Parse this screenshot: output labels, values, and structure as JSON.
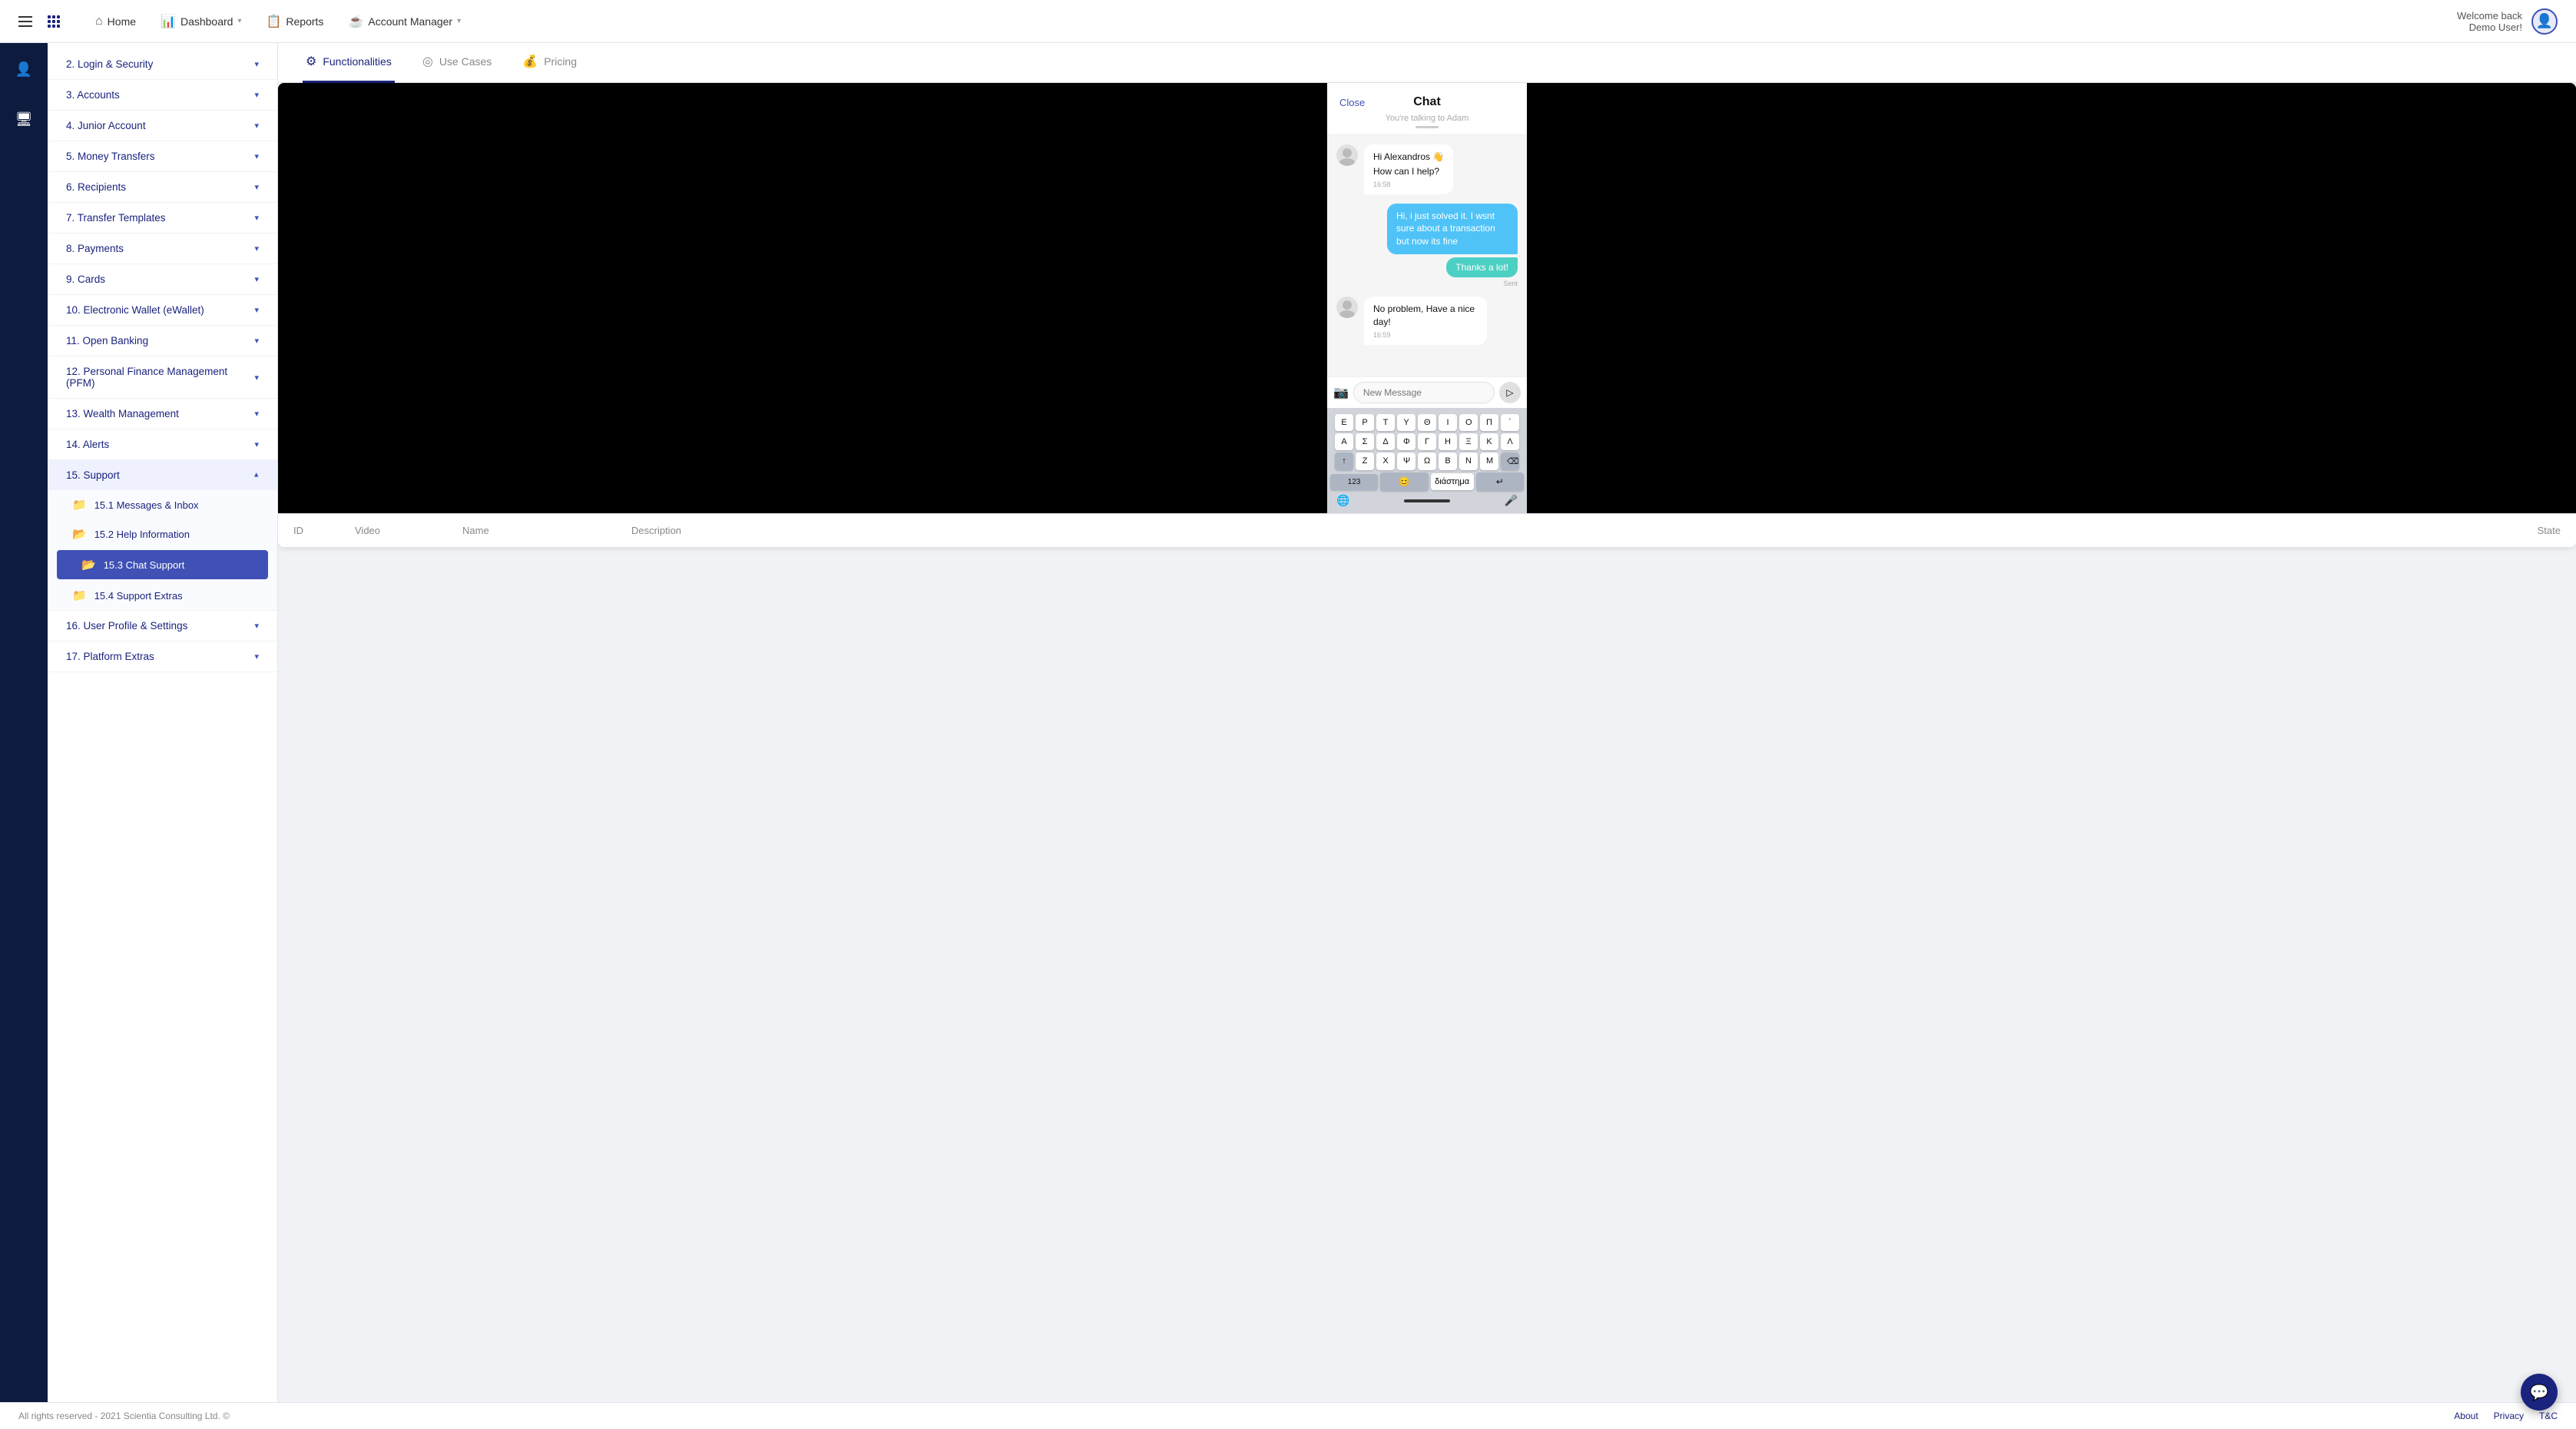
{
  "topnav": {
    "home_label": "Home",
    "dashboard_label": "Dashboard",
    "reports_label": "Reports",
    "account_manager_label": "Account Manager",
    "welcome_text": "Welcome back",
    "user_text": "Demo User!"
  },
  "tabs": {
    "functionalities_label": "Functionalities",
    "use_cases_label": "Use Cases",
    "pricing_label": "Pricing"
  },
  "sidebar": {
    "sections": [
      {
        "id": "login-security",
        "label": "2. Login & Security",
        "expanded": false
      },
      {
        "id": "accounts",
        "label": "3. Accounts",
        "expanded": false
      },
      {
        "id": "junior-account",
        "label": "4. Junior Account",
        "expanded": false
      },
      {
        "id": "money-transfers",
        "label": "5. Money Transfers",
        "expanded": false
      },
      {
        "id": "recipients",
        "label": "6. Recipients",
        "expanded": false
      },
      {
        "id": "transfer-templates",
        "label": "7. Transfer Templates",
        "expanded": false
      },
      {
        "id": "payments",
        "label": "8. Payments",
        "expanded": false
      },
      {
        "id": "cards",
        "label": "9. Cards",
        "expanded": false
      },
      {
        "id": "ewallet",
        "label": "10. Electronic Wallet (eWallet)",
        "expanded": false
      },
      {
        "id": "open-banking",
        "label": "11. Open Banking",
        "expanded": false
      },
      {
        "id": "pfm",
        "label": "12. Personal Finance Management (PFM)",
        "expanded": false
      },
      {
        "id": "wealth-management",
        "label": "13. Wealth Management",
        "expanded": false
      },
      {
        "id": "alerts",
        "label": "14. Alerts",
        "expanded": false
      },
      {
        "id": "support",
        "label": "15. Support",
        "expanded": true
      }
    ],
    "support_sub_items": [
      {
        "id": "messages-inbox",
        "label": "15.1 Messages & Inbox",
        "active": false
      },
      {
        "id": "help-information",
        "label": "15.2 Help Information",
        "active": false
      },
      {
        "id": "chat-support",
        "label": "15.3 Chat Support",
        "active": true
      },
      {
        "id": "support-extras",
        "label": "15.4 Support Extras",
        "active": false
      }
    ],
    "more_sections": [
      {
        "id": "user-profile",
        "label": "16. User Profile & Settings",
        "expanded": false
      },
      {
        "id": "platform-extras",
        "label": "17. Platform Extras",
        "expanded": false
      }
    ]
  },
  "chat": {
    "header_title": "Chat",
    "close_label": "Close",
    "talking_to": "You're talking to Adam",
    "msg1": "Hi Alexandros 👋",
    "msg2": "How can I help?",
    "msg2_time": "16:58",
    "msg3": "Hi, i just solved it. I wsnt sure about a transaction but now its fine",
    "msg4": "Thanks a lot!",
    "msg4_status": "Sent",
    "msg5": "No problem, Have a nice day!",
    "msg5_time": "16:59",
    "input_placeholder": "New Message",
    "keyboard_rows": [
      [
        "Ε",
        "Ρ",
        "Τ",
        "Υ",
        "Θ",
        "Ι",
        "Ο",
        "Π",
        "΄"
      ],
      [
        "Α",
        "Σ",
        "Δ",
        "Φ",
        "Γ",
        "Η",
        "Ξ",
        "Κ",
        "Λ"
      ],
      [
        "↑",
        "Ζ",
        "Χ",
        "Ψ",
        "Ω",
        "Β",
        "Ν",
        "Μ",
        "⌫"
      ]
    ],
    "spacebar_label": "διάστημα",
    "num_label": "123",
    "return_label": "↵"
  },
  "table_headers": {
    "id": "ID",
    "video": "Video",
    "name": "Name",
    "description": "Description",
    "state": "State"
  },
  "footer": {
    "copyright": "All rights reserved - 2021 Scientia Consulting Ltd. ©",
    "about": "About",
    "privacy": "Privacy",
    "tsc": "T&C"
  }
}
